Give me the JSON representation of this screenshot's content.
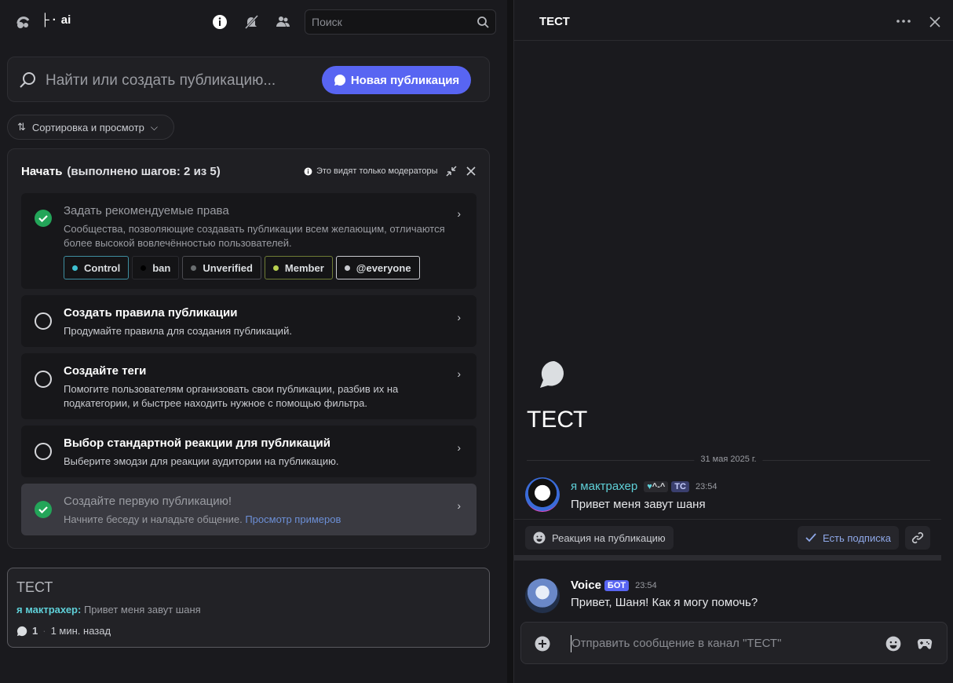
{
  "header": {
    "channel_name": "ai",
    "channel_prefix": "├ ·",
    "search_placeholder": "Поиск"
  },
  "forum": {
    "search_placeholder": "Найти или создать публикацию...",
    "new_post_label": "Новая публикация",
    "sort_label": "Сортировка и просмотр"
  },
  "onboarding": {
    "title": "Начать",
    "progress": "(выполнено шагов: 2 из 5)",
    "mod_note": "Это видят только модераторы",
    "steps": [
      {
        "title": "Задать рекомендуемые права",
        "desc": "Сообщества, позволяющие создавать публикации всем желающим, отличаются более высокой вовлечённостью пользователей.",
        "done": true
      },
      {
        "title": "Создать правила публикации",
        "desc": "Продумайте правила для создания публикаций.",
        "done": false
      },
      {
        "title": "Создайте теги",
        "desc": "Помогите пользователям организовать свои публикации, разбив их на подкатегории, и быстрее находить нужное с помощью фильтра.",
        "done": false
      },
      {
        "title": "Выбор стандартной реакции для публикаций",
        "desc": "Выберите эмодзи для реакции аудитории на публикацию.",
        "done": false
      },
      {
        "title": "Создайте первую публикацию!",
        "desc": "Начните беседу и наладьте общение.",
        "link": "Просмотр примеров",
        "done": true
      }
    ],
    "roles": [
      {
        "name": "Control",
        "color": "#3ec0d0"
      },
      {
        "name": "ban",
        "color": "#000000"
      },
      {
        "name": "Unverified",
        "color": "#6a6e70"
      },
      {
        "name": "Member",
        "color": "#b8d050"
      },
      {
        "name": "@everyone",
        "color": "#c9cbd0"
      }
    ]
  },
  "post_card": {
    "title": "ТЕСТ",
    "author": "я мактрахер:",
    "preview": "Привет меня завут шаня",
    "replies": "1",
    "time": "1 мин. назад"
  },
  "thread": {
    "header_title": "ТЕСТ",
    "big_title": "ТЕСТ",
    "date": "31 мая 2025 г.",
    "messages": [
      {
        "author": "я мактрахер",
        "author_color": "#5fd0d8",
        "badge": "^-^",
        "tag": "TC",
        "time": "23:54",
        "text": "Привет меня завут шаня"
      },
      {
        "author": "Voice",
        "author_color": "#ffffff",
        "tag": "БОТ",
        "time": "23:54",
        "text": "Привет, Шаня! Как я могу помочь?"
      }
    ],
    "react_label": "Реакция на публикацию",
    "subscribed_label": "Есть подписка",
    "composer_placeholder": "Отправить сообщение в канал \"ТЕСТ\""
  }
}
